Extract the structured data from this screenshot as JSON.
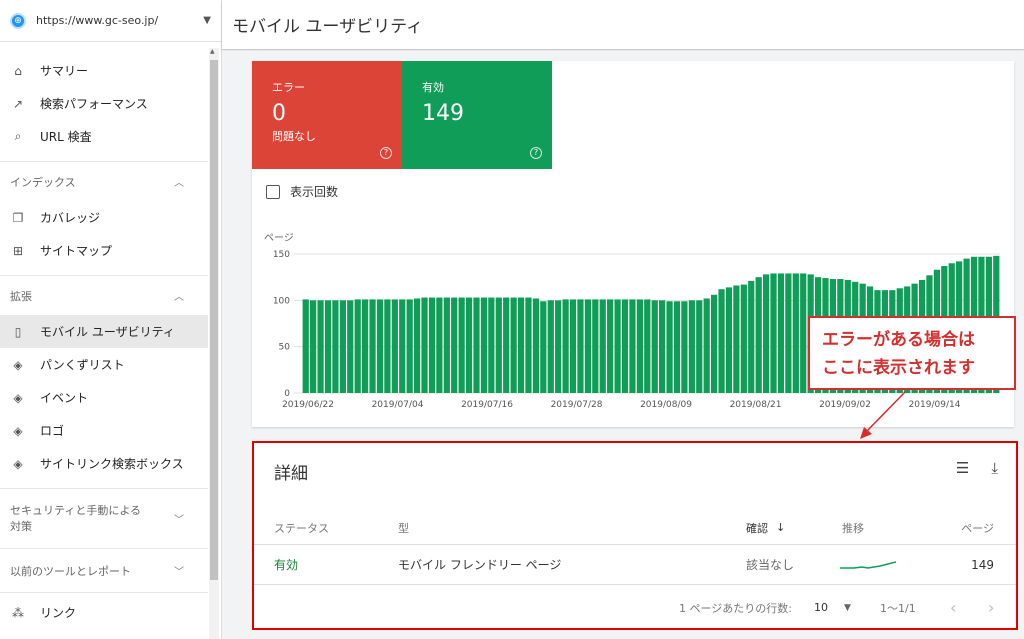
{
  "property": {
    "url": "https://www.gc-seo.jp/"
  },
  "nav": {
    "top_items": [
      {
        "label": "サマリー",
        "icon": "⌂"
      },
      {
        "label": "検索パフォーマンス",
        "icon": "↗"
      },
      {
        "label": "URL 検査",
        "icon": "⌕"
      }
    ],
    "sections": [
      {
        "title": "インデックス",
        "items": [
          {
            "label": "カバレッジ",
            "icon": "❐"
          },
          {
            "label": "サイトマップ",
            "icon": "⊞"
          }
        ]
      },
      {
        "title": "拡張",
        "items": [
          {
            "label": "モバイル ユーザビリティ",
            "icon": "▯"
          },
          {
            "label": "パンくずリスト",
            "icon": "◈"
          },
          {
            "label": "イベント",
            "icon": "◈"
          },
          {
            "label": "ロゴ",
            "icon": "◈"
          },
          {
            "label": "サイトリンク検索ボックス",
            "icon": "◈"
          }
        ]
      }
    ],
    "security_section": "セキュリティと手動による対策",
    "legacy_section": "以前のツールとレポート",
    "links_item": {
      "label": "リンク",
      "icon": "⁂"
    }
  },
  "header": {
    "title": "モバイル ユーザビリティ"
  },
  "summary": {
    "error": {
      "label": "エラー",
      "value": "0",
      "sub": "問題なし"
    },
    "valid": {
      "label": "有効",
      "value": "149"
    }
  },
  "checkbox_label": "表示回数",
  "chart_data": {
    "type": "bar",
    "ylabel": "ページ",
    "ylim": [
      0,
      150
    ],
    "yticks": [
      "150",
      "100",
      "50",
      "0"
    ],
    "xticks": [
      "2019/06/22",
      "2019/07/04",
      "2019/07/16",
      "2019/07/28",
      "2019/08/09",
      "2019/08/21",
      "2019/09/02",
      "2019/09/14"
    ],
    "color": "#0f9d58",
    "values": [
      101,
      100,
      100,
      100,
      100,
      100,
      100,
      101,
      101,
      101,
      101,
      101,
      101,
      101,
      101,
      102,
      103,
      103,
      103,
      103,
      103,
      103,
      103,
      103,
      103,
      103,
      103,
      103,
      103,
      103,
      103,
      102,
      99,
      100,
      100,
      101,
      101,
      101,
      101,
      101,
      101,
      101,
      101,
      101,
      101,
      101,
      101,
      100,
      100,
      99,
      99,
      99,
      100,
      100,
      102,
      106,
      112,
      114,
      116,
      117,
      121,
      125,
      128,
      129,
      129,
      129,
      129,
      129,
      128,
      125,
      124,
      123,
      123,
      122,
      120,
      118,
      115,
      111,
      111,
      111,
      113,
      115,
      118,
      122,
      127,
      133,
      137,
      140,
      142,
      145,
      147,
      147,
      147,
      148
    ]
  },
  "callout": {
    "line1": "エラーがある場合は",
    "line2": "ここに表示されます"
  },
  "details": {
    "title": "詳細",
    "columns": {
      "status": "ステータス",
      "type": "型",
      "confirm": "確認",
      "trend": "推移",
      "pages": "ページ"
    },
    "row": {
      "status": "有効",
      "type": "モバイル フレンドリー ページ",
      "confirm": "該当なし",
      "pages": "149"
    },
    "pager": {
      "rows_label": "1 ページあたりの行数:",
      "rows_value": "10",
      "range": "1〜1/1"
    }
  }
}
